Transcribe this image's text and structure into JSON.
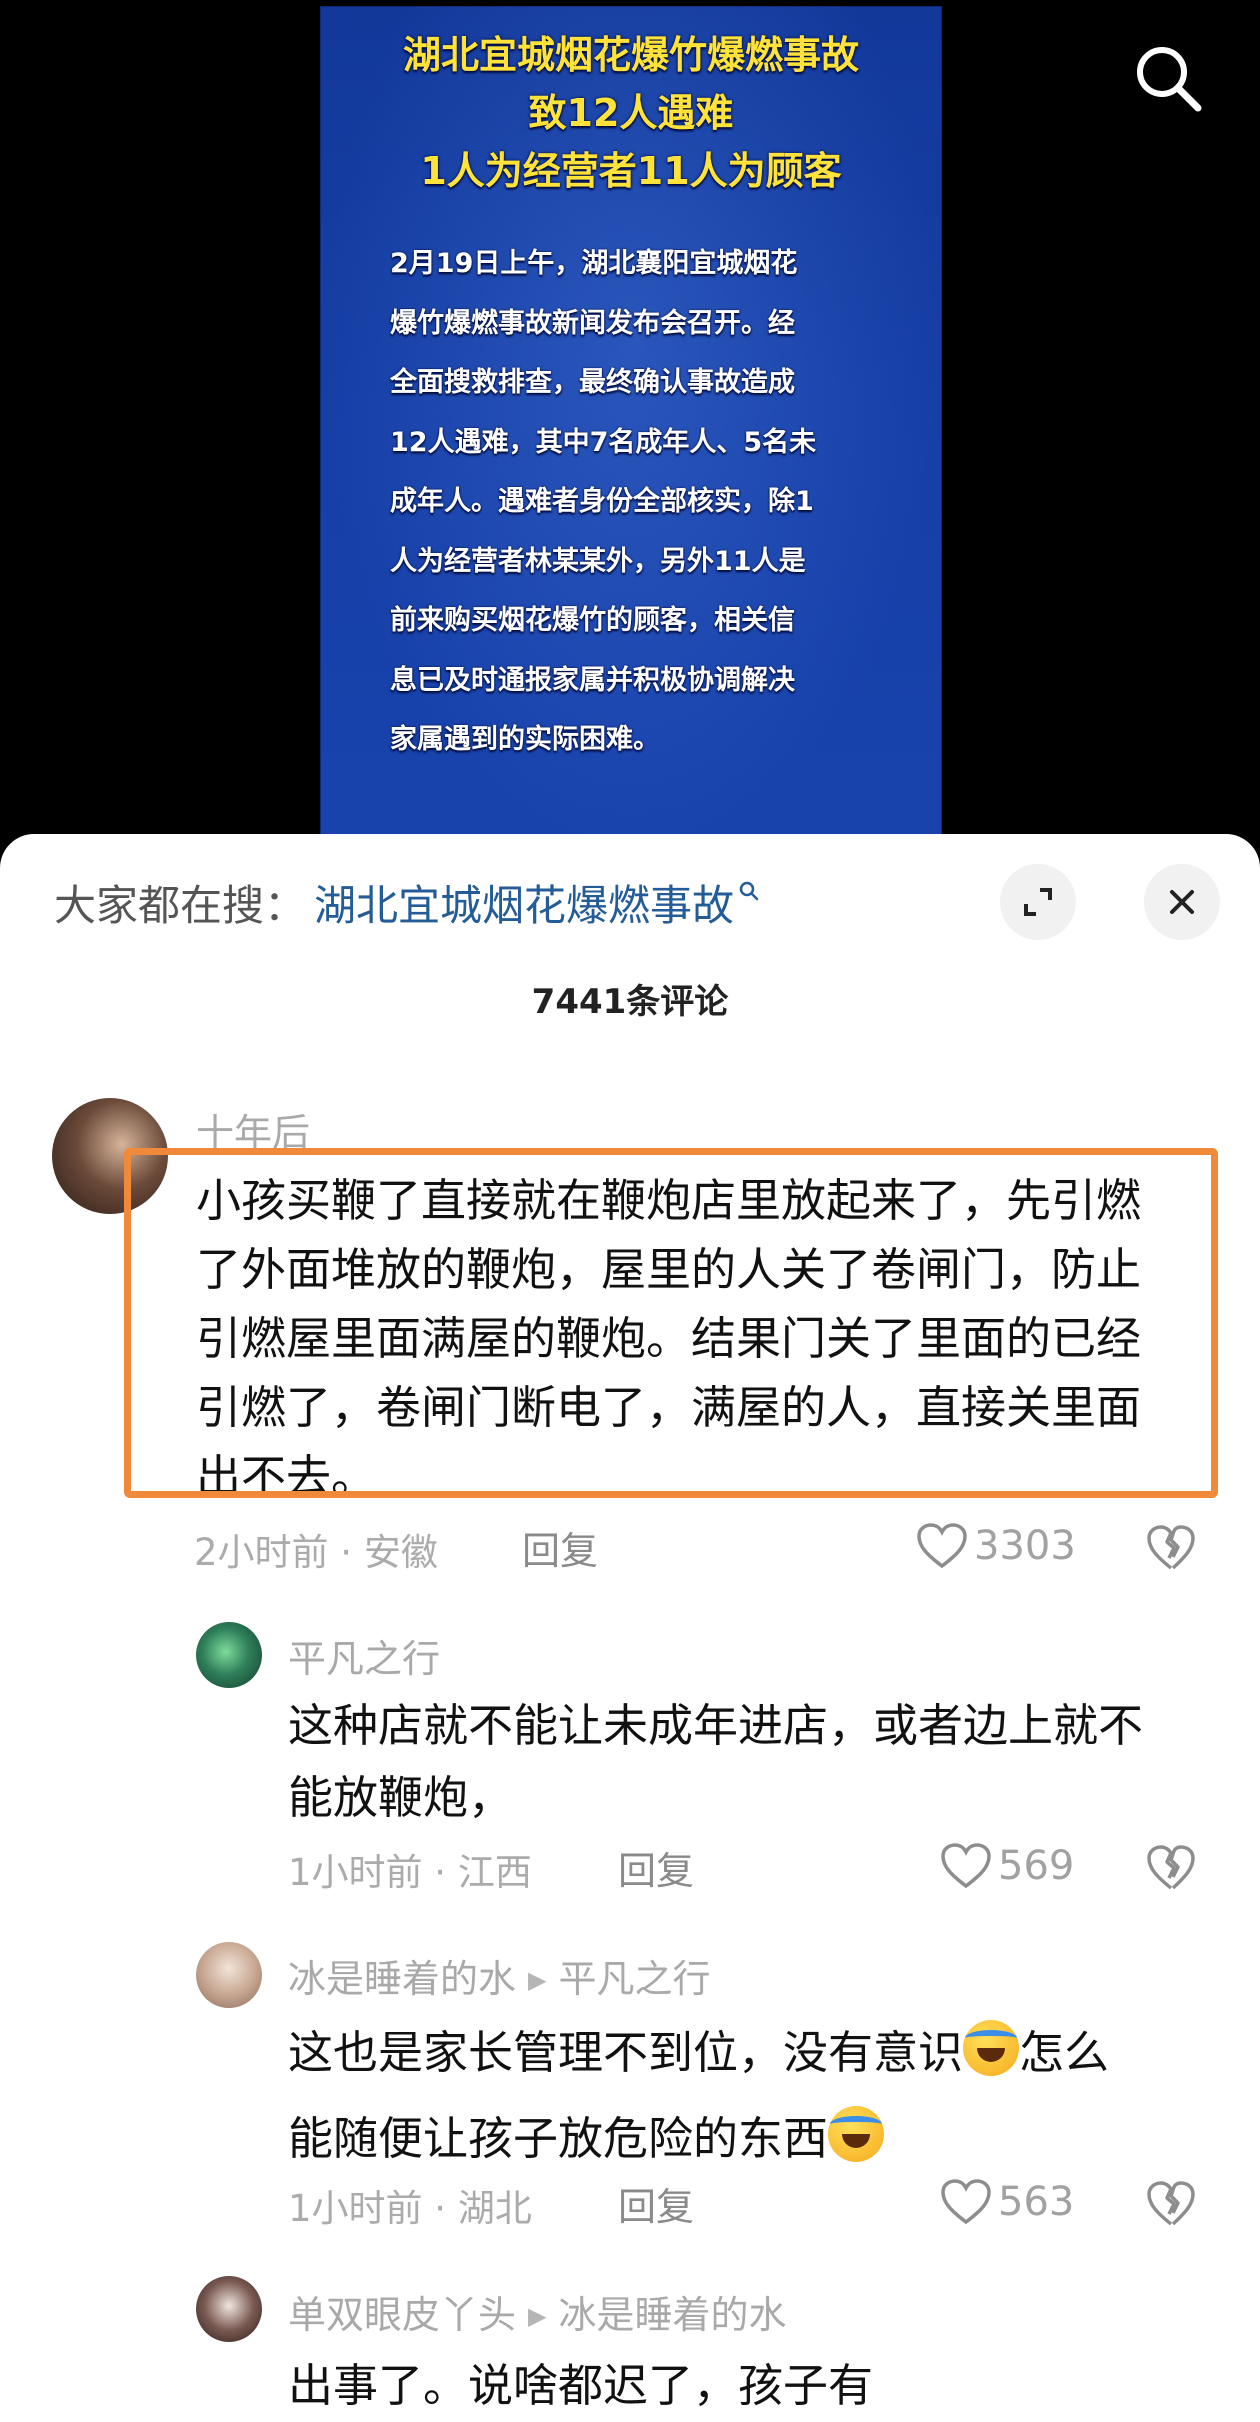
{
  "video": {
    "headline": [
      "湖北宜城烟花爆竹爆燃事故",
      "致12人遇难",
      "1人为经营者11人为顾客"
    ],
    "body_lines": [
      "2月19日上午，湖北襄阳宜城烟花",
      "爆竹爆燃事故新闻发布会召开。经",
      "全面搜救排查，最终确认事故造成",
      "12人遇难，其中7名成年人、5名未",
      "成年人。遇难者身份全部核实，除1",
      "人为经营者林某某外，另外11人是",
      "前来购买烟花爆竹的顾客，相关信",
      "息已及时通报家属并积极协调解决",
      "家属遇到的实际困难。"
    ]
  },
  "sheet": {
    "hot_search_label": "大家都在搜：",
    "hot_search_term": "湖北宜城烟花爆燃事故",
    "comment_count": "7441条评论"
  },
  "comments": [
    {
      "user": "十年后",
      "lines": [
        "小孩买鞭了直接就在鞭炮店里放起来了，先引燃",
        "了外面堆放的鞭炮，屋里的人关了卷闸门，防止",
        "引燃屋里面满屋的鞭炮。结果门关了里面的已经",
        "引燃了，卷闸门断电了，满屋的人，直接关里面",
        "出不去。"
      ],
      "meta": "2小时前 · 安徽",
      "reply": "回复",
      "likes": "3303"
    },
    {
      "user": "平凡之行",
      "lines": [
        "这种店就不能让未成年进店，或者边上就不",
        "能放鞭炮，"
      ],
      "meta": "1小时前 · 江西",
      "reply": "回复",
      "likes": "569"
    },
    {
      "user": "冰是睡着的水",
      "reply_to": "平凡之行",
      "lines": [
        "这也是家长管理不到位，没有意识",
        "怎么",
        "能随便让孩子放危险的东西"
      ],
      "meta": "1小时前 · 湖北",
      "reply": "回复",
      "likes": "563"
    },
    {
      "user": "单双眼皮丫头",
      "reply_to": "冰是睡着的水",
      "lines": [
        "出事了。说啥都迟了，孩子有"
      ]
    }
  ]
}
